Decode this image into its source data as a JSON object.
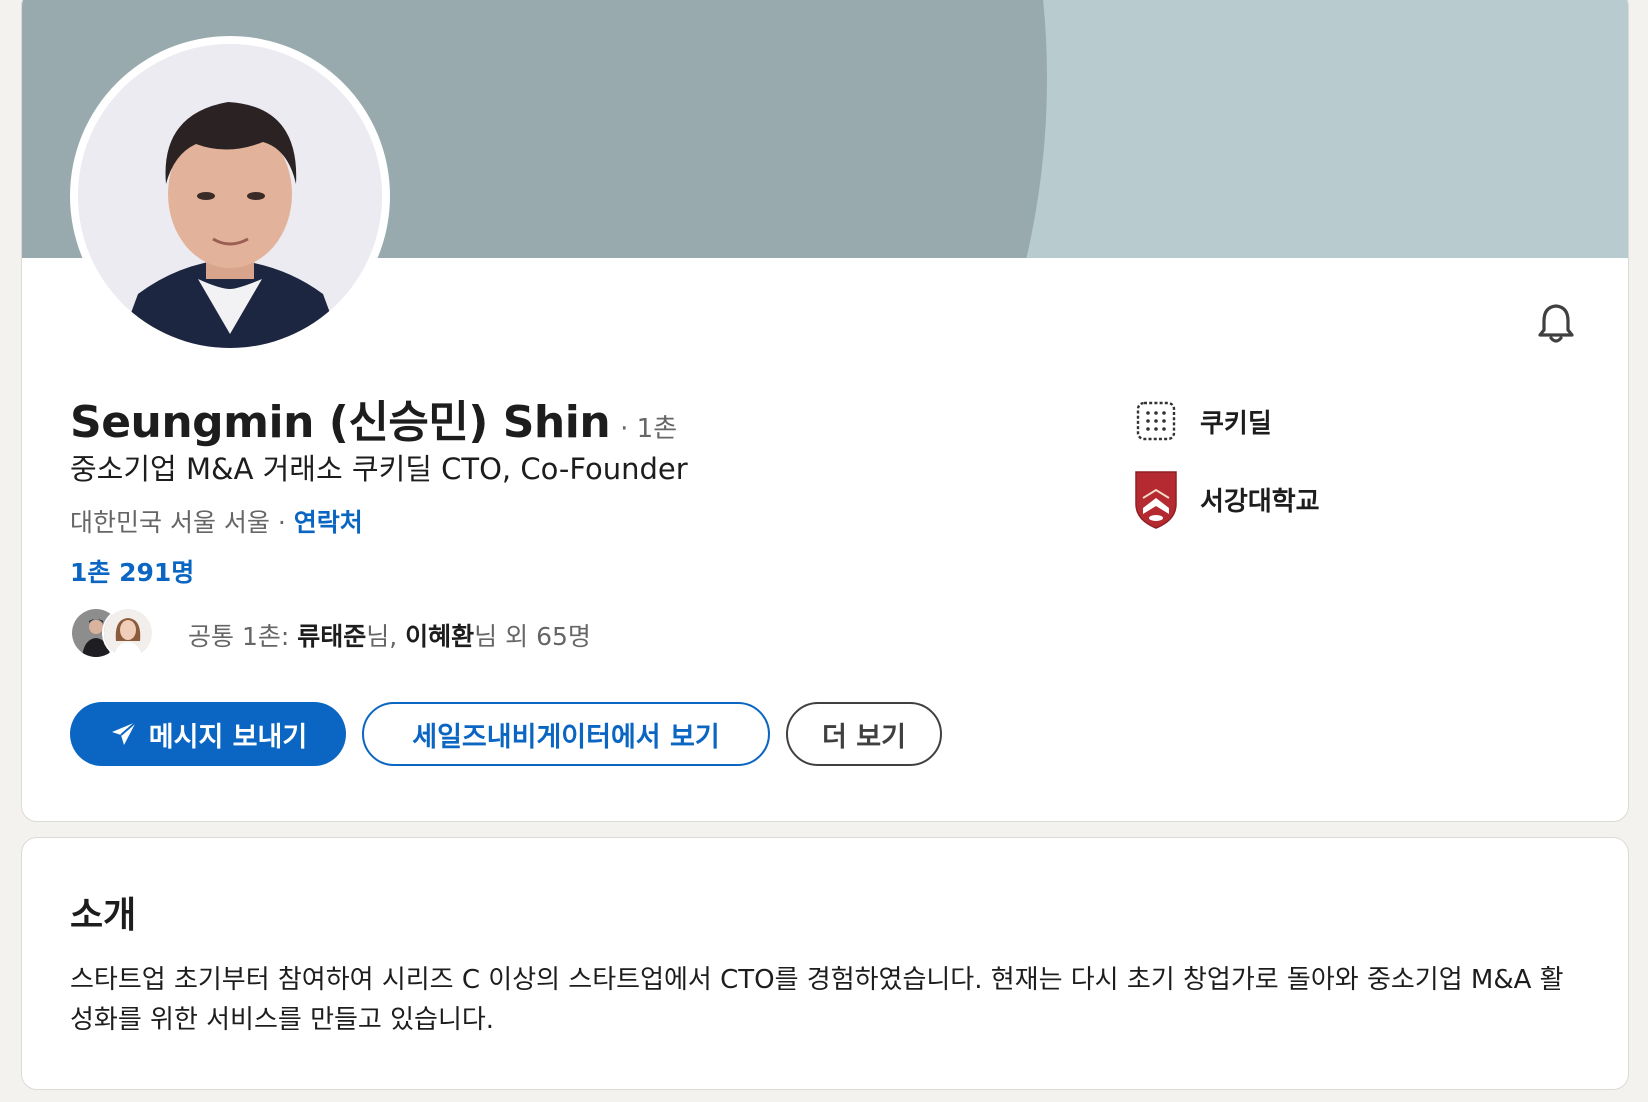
{
  "profile": {
    "name": "Seungmin (신승민) Shin",
    "degree": "· 1촌",
    "headline": "중소기업 M&A 거래소 쿠키딜 CTO, Co-Founder",
    "location": "대한민국 서울 서울",
    "location_separator": " · ",
    "contact_link": "연락처",
    "connections": "1촌 291명",
    "mutual": {
      "prefix": "공통 1촌: ",
      "person1": "류태준",
      "suffix1": "님, ",
      "person2": "이혜환",
      "suffix2": "님 외 65명"
    },
    "avatar": "profile-photo",
    "notification_icon": "bell-icon"
  },
  "actions": {
    "message": "메시지 보내기",
    "message_icon": "send-icon",
    "sales_navigator": "세일즈내비게이터에서 보기",
    "more": "더 보기"
  },
  "side_info": [
    {
      "label": "쿠키딜",
      "icon": "company-logo-icon"
    },
    {
      "label": "서강대학교",
      "icon": "school-crest-icon"
    }
  ],
  "about": {
    "title": "소개",
    "text": "스타트업 초기부터 참여하여 시리즈 C 이상의 스타트업에서 CTO를 경험하였습니다. 현재는 다시 초기 창업가로 돌아와 중소기업 M&A 활성화를 위한 서비스를 만들고 있습니다."
  },
  "colors": {
    "accent": "#0a66c2",
    "page_bg": "#f4f2ee",
    "cover_dark": "#98aaad",
    "cover_light": "#b8cbce"
  }
}
